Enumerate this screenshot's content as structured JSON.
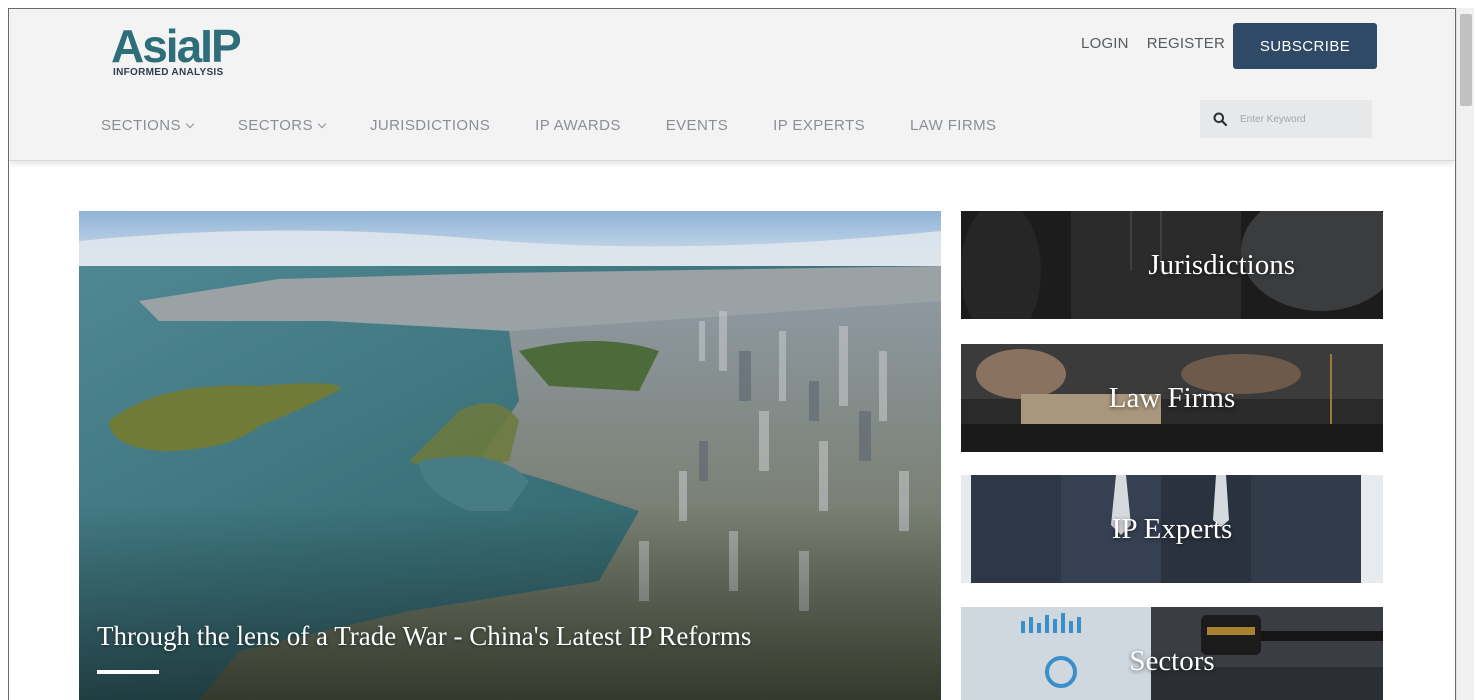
{
  "logo": {
    "main": "AsiaIP",
    "tagline": "INFORMED ANALYSIS",
    "color": "#2e6e7b"
  },
  "top_links": {
    "login": "LOGIN",
    "register": "REGISTER",
    "subscribe": "SUBSCRIBE"
  },
  "nav": {
    "items": [
      {
        "label": "SECTIONS",
        "dropdown": true
      },
      {
        "label": "SECTORS",
        "dropdown": true
      },
      {
        "label": "JURISDICTIONS",
        "dropdown": false
      },
      {
        "label": "IP AWARDS",
        "dropdown": false
      },
      {
        "label": "EVENTS",
        "dropdown": false
      },
      {
        "label": "IP EXPERTS",
        "dropdown": false
      },
      {
        "label": "LAW FIRMS",
        "dropdown": false
      }
    ]
  },
  "search": {
    "placeholder": "Enter Keyword",
    "icon": "search-icon"
  },
  "hero": {
    "title": "Through the lens of a Trade War - China's Latest IP Reforms"
  },
  "tiles": [
    {
      "label": "Jurisdictions"
    },
    {
      "label": "Law Firms"
    },
    {
      "label": "IP Experts"
    },
    {
      "label": "Sectors"
    }
  ],
  "colors": {
    "accent": "#2f4a66",
    "header_bg": "#f3f3f3",
    "nav_text": "#8a8f96"
  }
}
